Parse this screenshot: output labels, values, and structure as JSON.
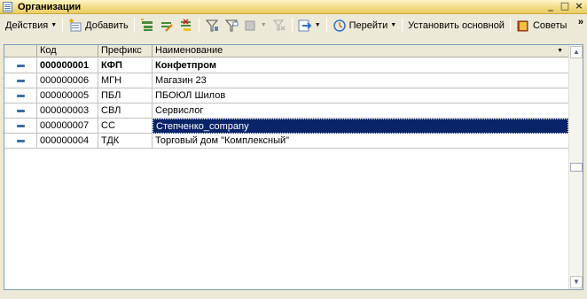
{
  "window": {
    "title": "Организации",
    "controls": [
      "_",
      "□",
      "×"
    ]
  },
  "toolbar": {
    "actions_label": "Действия",
    "add_label": "Добавить",
    "goto_label": "Перейти",
    "set_default_label": "Установить основной",
    "tips_label": "Советы",
    "more": "»"
  },
  "table": {
    "columns": [
      "Код",
      "Префикс",
      "Наименование"
    ],
    "rows": [
      {
        "code": "000000001",
        "prefix": "КФП",
        "name": "Конфетпром",
        "bold": true,
        "selected": false
      },
      {
        "code": "000000006",
        "prefix": "МГН",
        "name": "Магазин 23",
        "bold": false,
        "selected": false
      },
      {
        "code": "000000005",
        "prefix": "ПБЛ",
        "name": "ПБОЮЛ  Шилов",
        "bold": false,
        "selected": false
      },
      {
        "code": "000000003",
        "prefix": "СВЛ",
        "name": "Сервислог",
        "bold": false,
        "selected": false
      },
      {
        "code": "000000007",
        "prefix": "СС",
        "name": "Степченко_company",
        "bold": false,
        "selected": true
      },
      {
        "code": "000000004",
        "prefix": "ТДК",
        "name": "Торговый дом \"Комплексный\"",
        "bold": false,
        "selected": false
      }
    ]
  },
  "colors": {
    "selection": "#0a246a",
    "titlebar": "#f3de8a",
    "row_marker": "#3a6ea5"
  }
}
